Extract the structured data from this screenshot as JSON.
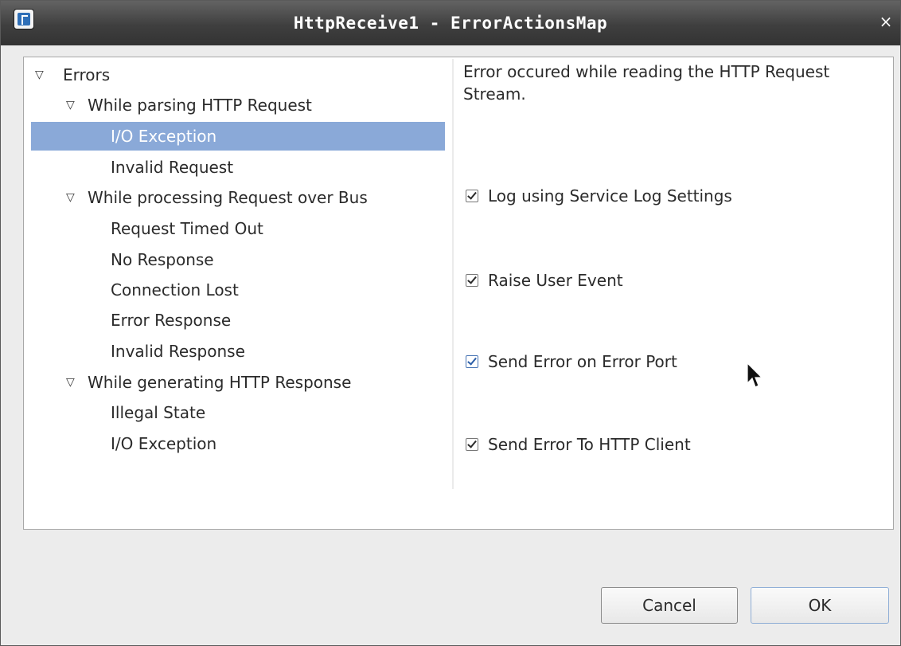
{
  "window": {
    "title": "HttpReceive1 - ErrorActionsMap",
    "close_glyph": "×",
    "icon": "app-icon"
  },
  "tree": {
    "caret_glyph": "▽",
    "items": [
      {
        "label": "Errors",
        "level": 0,
        "expanded": true,
        "selected": false
      },
      {
        "label": "While parsing HTTP Request",
        "level": 1,
        "expanded": true,
        "selected": false
      },
      {
        "label": "I/O Exception",
        "level": 2,
        "selected": true
      },
      {
        "label": "Invalid Request",
        "level": 2,
        "selected": false
      },
      {
        "label": "While processing Request over Bus",
        "level": 1,
        "expanded": true,
        "selected": false
      },
      {
        "label": "Request Timed Out",
        "level": 2,
        "selected": false
      },
      {
        "label": "No Response",
        "level": 2,
        "selected": false
      },
      {
        "label": "Connection Lost",
        "level": 2,
        "selected": false
      },
      {
        "label": "Error Response",
        "level": 2,
        "selected": false
      },
      {
        "label": "Invalid Response",
        "level": 2,
        "selected": false
      },
      {
        "label": "While generating HTTP Response",
        "level": 1,
        "expanded": true,
        "selected": false
      },
      {
        "label": "Illegal State",
        "level": 2,
        "selected": false
      },
      {
        "label": "I/O Exception",
        "level": 2,
        "selected": false
      }
    ]
  },
  "detail": {
    "description": "Error occured while reading the HTTP Request Stream.",
    "options": [
      {
        "label": "Log using Service Log Settings",
        "checked": true
      },
      {
        "label": "Raise User Event",
        "checked": true
      },
      {
        "label": "Send Error on Error Port",
        "checked": true
      },
      {
        "label": "Send Error To HTTP Client",
        "checked": true
      }
    ]
  },
  "buttons": {
    "cancel_label": "Cancel",
    "ok_label": "OK"
  },
  "colors": {
    "selection": "#8aa9d8",
    "titlebar": "#3f3f3f",
    "accent": "#2c5fa8"
  }
}
